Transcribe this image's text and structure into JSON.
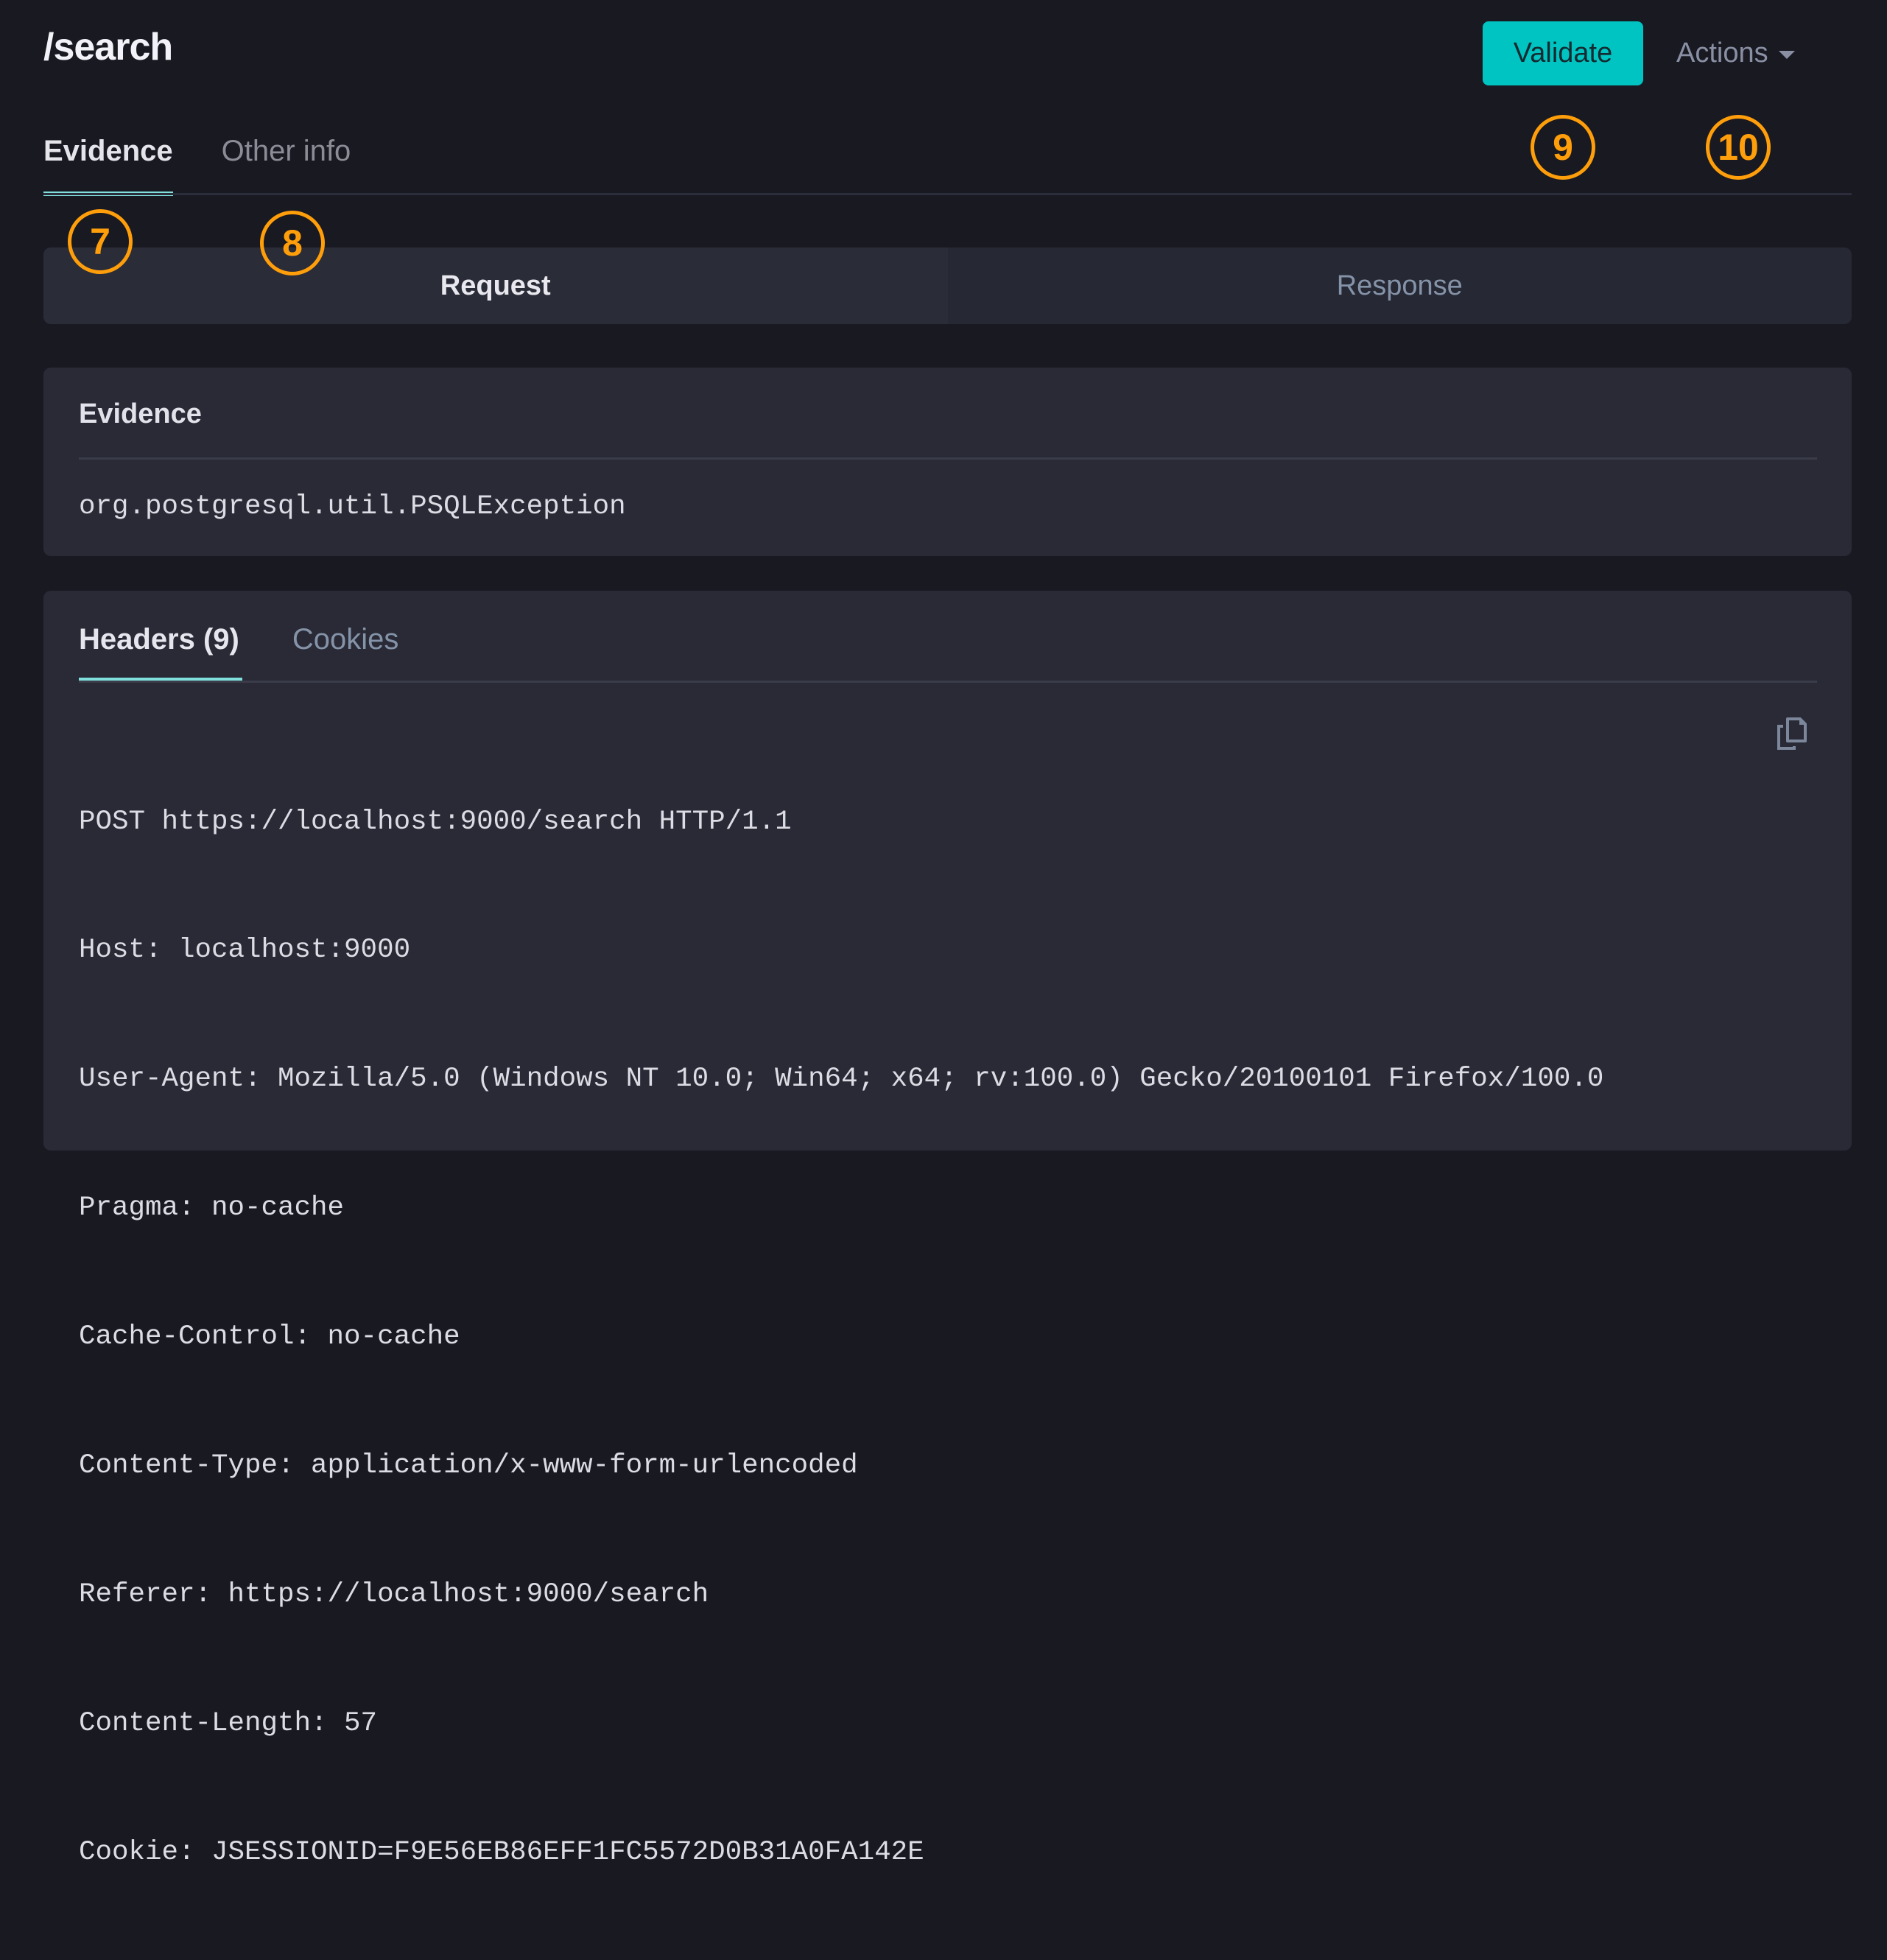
{
  "header": {
    "title": "/search",
    "validate_label": "Validate",
    "actions_label": "Actions",
    "accent_color": "#00c4c1"
  },
  "main_tabs": [
    {
      "label": "Evidence",
      "active": true
    },
    {
      "label": "Other info",
      "active": false
    }
  ],
  "markers": [
    "7",
    "8",
    "9",
    "10"
  ],
  "segmented": {
    "request_label": "Request",
    "response_label": "Response",
    "selected": "Request"
  },
  "evidence": {
    "heading": "Evidence",
    "value": "org.postgresql.util.PSQLException"
  },
  "request_panel": {
    "tabs": [
      {
        "label": "Headers (9)",
        "active": true
      },
      {
        "label": "Cookies",
        "active": false
      }
    ],
    "copy_icon": "copy-icon",
    "lines": [
      "POST https://localhost:9000/search HTTP/1.1",
      "Host: localhost:9000",
      "User-Agent: Mozilla/5.0 (Windows NT 10.0; Win64; x64; rv:100.0) Gecko/20100101 Firefox/100.0",
      "Pragma: no-cache",
      "Cache-Control: no-cache",
      "Content-Type: application/x-www-form-urlencoded",
      "Referer: https://localhost:9000/search",
      "Content-Length: 57",
      "Cookie: JSESSIONID=F9E56EB86EFF1FC5572D0B31A0FA142E"
    ]
  }
}
